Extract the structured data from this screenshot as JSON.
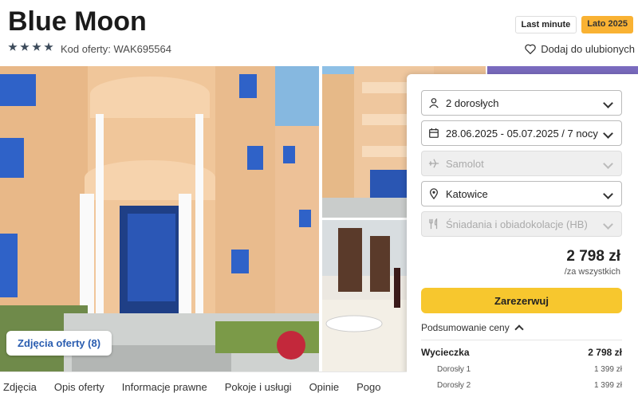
{
  "header": {
    "title": "Blue Moon",
    "stars": 4,
    "offer_code": "Kod oferty: WAK695564",
    "tag_last_minute": "Last minute",
    "tag_season": "Lato 2025",
    "favorite_label": "Dodaj do ulubionych"
  },
  "gallery": {
    "photos_button": "Zdjęcia oferty (8)"
  },
  "booking": {
    "travelers": "2 dorosłych",
    "dates": "28.06.2025 - 05.07.2025 / 7 nocy",
    "transport": "Samolot",
    "departure": "Katowice",
    "board": "Śniadania i obiadokolacje (HB)",
    "price": "2 798 zł",
    "price_note": "/za wszystkich",
    "reserve_button": "Zarezerwuj",
    "summary_toggle": "Podsumowanie ceny",
    "summary": {
      "label": "Wycieczka",
      "total": "2 798 zł",
      "rows": [
        {
          "label": "Dorosły 1",
          "value": "1 399 zł"
        },
        {
          "label": "Dorosły 2",
          "value": "1 399 zł"
        }
      ]
    }
  },
  "tabs": [
    "Zdjęcia",
    "Opis oferty",
    "Informacje prawne",
    "Pokoje i usługi",
    "Opinie",
    "Pogo"
  ],
  "colors": {
    "accent_yellow": "#f7c72e",
    "season_tag": "#f9b233",
    "link_blue": "#2a5db0"
  }
}
